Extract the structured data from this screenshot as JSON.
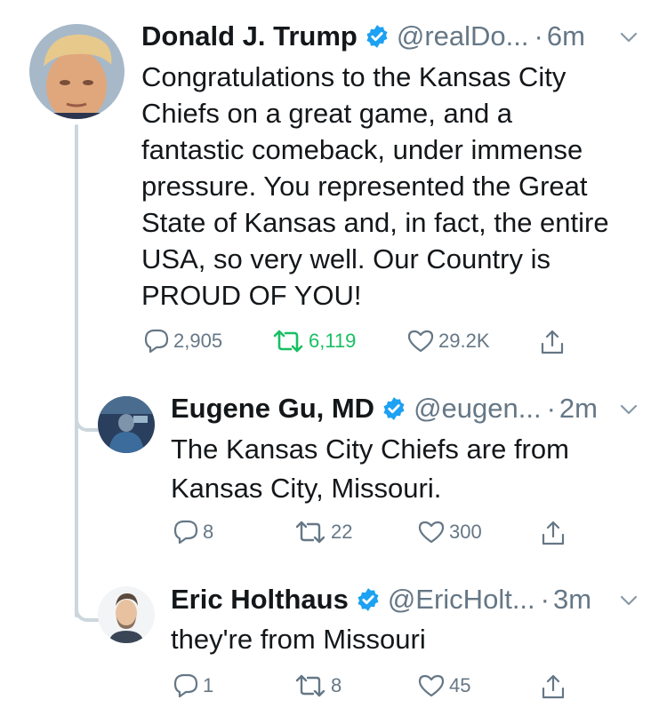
{
  "tweets": [
    {
      "name": "Donald J. Trump",
      "handle": "@realDo...",
      "time": "6m",
      "text": "Congratulations to the Kansas City Chiefs on a great game, and a fantastic comeback, under immense pressure. You represented the Great State of Kansas and, in fact, the entire USA, so very well. Our Country is PROUD OF YOU!",
      "text_lines": [
        "Congratulations to the Kansas City",
        "Chiefs on a great game, and a",
        "fantastic comeback, under immense",
        "pressure. You represented the Great",
        "State of Kansas and, in fact, the entire",
        "USA, so very well. Our Country is",
        "PROUD OF YOU!"
      ],
      "replies": "2,905",
      "retweets": "6,119",
      "likes": "29.2K",
      "retweeted": true
    },
    {
      "name": "Eugene Gu, MD",
      "handle": "@eugen...",
      "time": "2m",
      "text_lines": [
        "The Kansas City Chiefs are from",
        "Kansas City, Missouri."
      ],
      "replies": "8",
      "retweets": "22",
      "likes": "300",
      "retweeted": false
    },
    {
      "name": "Eric Holthaus",
      "handle": "@EricHolt...",
      "time": "3m",
      "text_lines": [
        "they're from Missouri"
      ],
      "replies": "1",
      "retweets": "8",
      "likes": "45",
      "retweeted": false
    }
  ],
  "colors": {
    "verified": "#1da1f2",
    "muted": "#657786",
    "retweet_active": "#17bf63",
    "thread_line": "#ccd6dd"
  },
  "icons": [
    "verified-badge-icon",
    "caret-down-icon",
    "reply-icon",
    "retweet-icon",
    "like-icon",
    "share-icon"
  ]
}
